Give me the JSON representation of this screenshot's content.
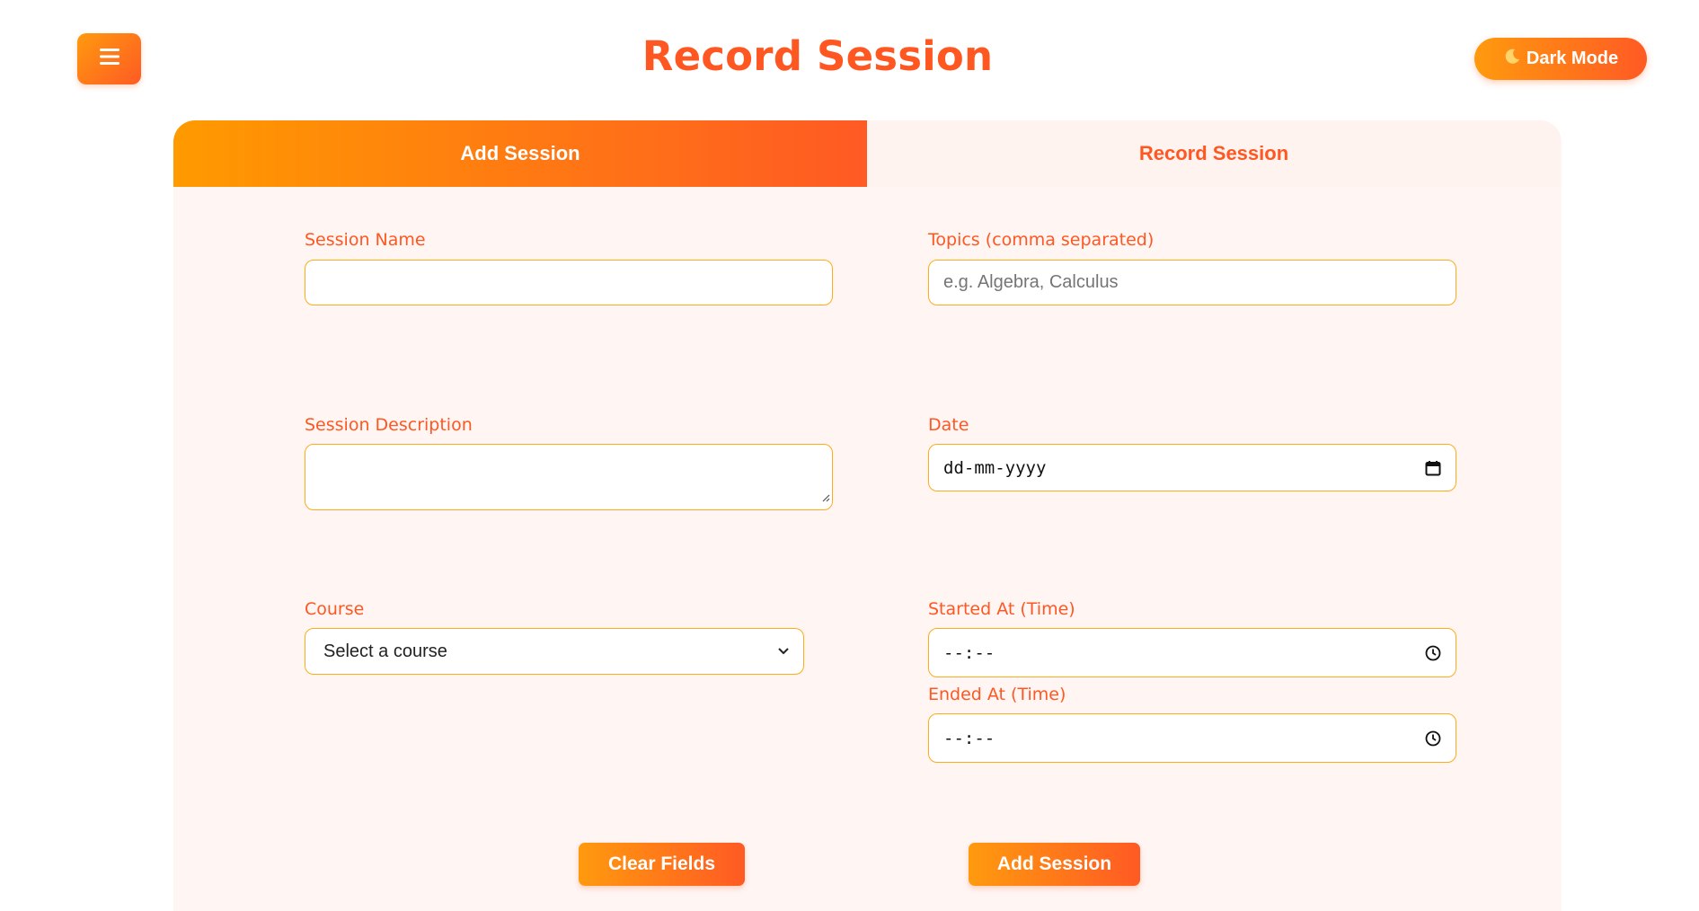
{
  "header": {
    "menu_icon": "hamburger-icon",
    "title": "Record Session",
    "dark_mode": {
      "icon": "moon-icon",
      "label": "Dark Mode"
    }
  },
  "tabs": [
    {
      "label": "Add Session",
      "active": true
    },
    {
      "label": "Record Session",
      "active": false
    }
  ],
  "form": {
    "session_name": {
      "label": "Session Name",
      "value": "",
      "placeholder": ""
    },
    "topics": {
      "label": "Topics (comma separated)",
      "value": "",
      "placeholder": "e.g. Algebra, Calculus"
    },
    "session_description": {
      "label": "Session Description",
      "value": ""
    },
    "date": {
      "label": "Date",
      "value": "dd-mm-yyyy",
      "icon": "calendar-icon"
    },
    "course": {
      "label": "Course",
      "selected": "Select a course",
      "icon": "chevron-down-icon"
    },
    "started_at": {
      "label": "Started At (Time)",
      "value": "--:--",
      "icon": "clock-icon"
    },
    "ended_at": {
      "label": "Ended At (Time)",
      "value": "--:--",
      "icon": "clock-icon"
    }
  },
  "actions": {
    "clear_label": "Clear Fields",
    "add_label": "Add Session"
  },
  "colors": {
    "accent": "#ff5722",
    "gradient_start": "#ff9a00",
    "gradient_end": "#ff5a24",
    "input_border": "#ffab1a",
    "card_background": "#fff5f3"
  }
}
